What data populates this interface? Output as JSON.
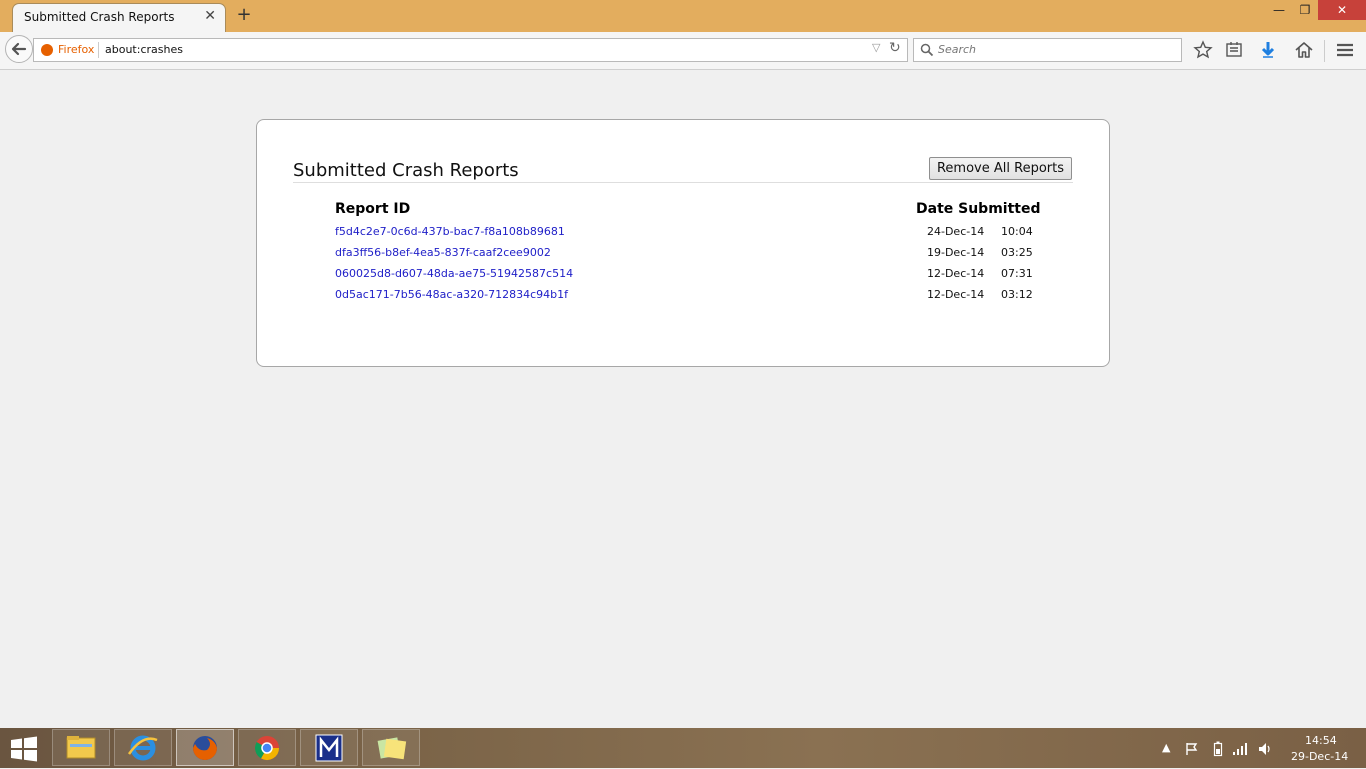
{
  "browser": {
    "tab_title": "Submitted Crash Reports",
    "tab_close": "✕",
    "new_tab": "+",
    "window_minimize": "—",
    "window_restore": "❐",
    "window_close": "✕",
    "identity_label": "Firefox",
    "url": "about:crashes",
    "search_placeholder": "Search"
  },
  "page": {
    "title": "Submitted Crash Reports",
    "remove_button": "Remove All Reports",
    "col_report_id": "Report ID",
    "col_date": "Date Submitted",
    "reports": [
      {
        "id": "f5d4c2e7-0c6d-437b-bac7-f8a108b89681",
        "date": "24-Dec-14",
        "time": "10:04"
      },
      {
        "id": "dfa3ff56-b8ef-4ea5-837f-caaf2cee9002",
        "date": "19-Dec-14",
        "time": "03:25"
      },
      {
        "id": "060025d8-d607-48da-ae75-51942587c514",
        "date": "12-Dec-14",
        "time": "07:31"
      },
      {
        "id": "0d5ac171-7b56-48ac-a320-712834c94b1f",
        "date": "12-Dec-14",
        "time": "03:12"
      }
    ]
  },
  "taskbar": {
    "apps": [
      "file-explorer-icon",
      "internet-explorer-icon",
      "firefox-icon",
      "chrome-icon",
      "m-app-icon",
      "sticky-notes-icon"
    ],
    "active_app": "firefox-icon",
    "clock_time": "14:54",
    "clock_date": "29-Dec-14"
  }
}
